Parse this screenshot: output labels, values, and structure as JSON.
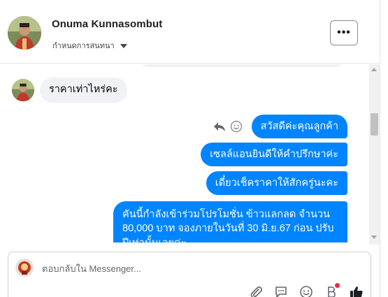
{
  "header": {
    "name": "Onuma Kunnasombut",
    "subtitle": "กำหนดการสนทนา",
    "more_label": "•••"
  },
  "messages": {
    "incoming": [
      {
        "text": "ราคาเท่าไหร่คะ"
      }
    ],
    "outgoing": [
      {
        "text": "สวัสดีค่ะคุณลูกค้า"
      },
      {
        "text": "เซลล์แอนยินดีให้คำปรึกษาค่ะ"
      },
      {
        "text": "เดี๋ยวเช็คราคาให้สักครู่นะคะ"
      },
      {
        "text": "คันนี้กำลังเข้าร่วมโปรโมชั่น ข้าวแลกลด จำนวน 80,000 บาท จองภายในวันที่ 30 มิ.ย.67  ก่อน ปรับปีเท่านั้นเลยค่ะ"
      }
    ]
  },
  "composer": {
    "placeholder": "ตอบกลับใน Messenger..."
  },
  "icons": {
    "reply": "reply-icon",
    "react": "smiley-icon",
    "attach": "paperclip-icon",
    "quick_reply": "speech-bubble-icon",
    "emoji": "emoji-icon",
    "bitcoin": "b-icon",
    "like": "thumbs-up-icon"
  },
  "colors": {
    "outgoing_bubble": "#0084ff",
    "incoming_bubble": "#f0f2f5",
    "notification_dot": "#f02849"
  }
}
